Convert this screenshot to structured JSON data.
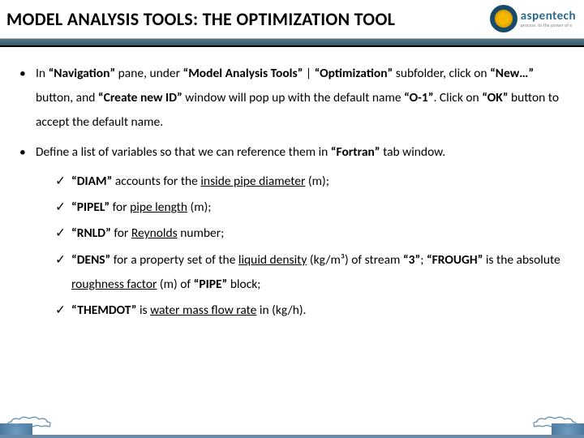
{
  "header": {
    "title": "MODEL ANALYSIS TOOLS: THE OPTIMIZATION TOOL",
    "logo_name": "aspentech",
    "logo_tag": "process. to the power of e"
  },
  "bullets": [
    {
      "parts": [
        {
          "t": "In "
        },
        {
          "t": "“Navigation”",
          "b": true
        },
        {
          "t": " pane, under "
        },
        {
          "t": "“Model Analysis Tools”",
          "b": true
        },
        {
          "t": " | "
        },
        {
          "t": "“Optimization”",
          "b": true
        },
        {
          "t": " subfolder, click on "
        },
        {
          "t": "“New…”",
          "b": true
        },
        {
          "t": " button, and "
        },
        {
          "t": "“Create new ID”",
          "b": true
        },
        {
          "t": " window will pop up with the default name "
        },
        {
          "t": "“O-1”",
          "b": true
        },
        {
          "t": ". Click on "
        },
        {
          "t": "“OK”",
          "b": true
        },
        {
          "t": " button to accept the default name."
        }
      ]
    },
    {
      "parts": [
        {
          "t": "Define a list of variables so that we can reference them in "
        },
        {
          "t": "“Fortran”",
          "b": true
        },
        {
          "t": " tab window."
        }
      ]
    }
  ],
  "subs": [
    [
      {
        "t": "“DIAM”",
        "b": true
      },
      {
        "t": " accounts for the "
      },
      {
        "t": "inside pipe diameter",
        "ul": true
      },
      {
        "t": " (m);"
      }
    ],
    [
      {
        "t": "“PIPEL”",
        "b": true
      },
      {
        "t": " for "
      },
      {
        "t": "pipe length",
        "ul": true
      },
      {
        "t": " (m);"
      }
    ],
    [
      {
        "t": " "
      },
      {
        "t": "“RNLD”",
        "b": true
      },
      {
        "t": " for "
      },
      {
        "t": "Reynolds",
        "ul": true
      },
      {
        "t": " number;"
      }
    ],
    [
      {
        "t": " "
      },
      {
        "t": "“DENS”",
        "b": true
      },
      {
        "t": " for a property set of the "
      },
      {
        "t": "liquid density",
        "ul": true
      },
      {
        "t": " (kg/m³) of stream "
      },
      {
        "t": "“3”",
        "b": true
      },
      {
        "t": "; "
      },
      {
        "t": "“FROUGH”",
        "b": true
      },
      {
        "t": " is the absolute "
      },
      {
        "t": "roughness factor",
        "ul": true
      },
      {
        "t": " (m) of "
      },
      {
        "t": "“PIPE”",
        "b": true
      },
      {
        "t": " block;"
      }
    ],
    [
      {
        "t": "“THEMDOT”",
        "b": true
      },
      {
        "t": " is "
      },
      {
        "t": "water mass flow rate",
        "ul": true
      },
      {
        "t": " in (kg/h)."
      }
    ]
  ]
}
